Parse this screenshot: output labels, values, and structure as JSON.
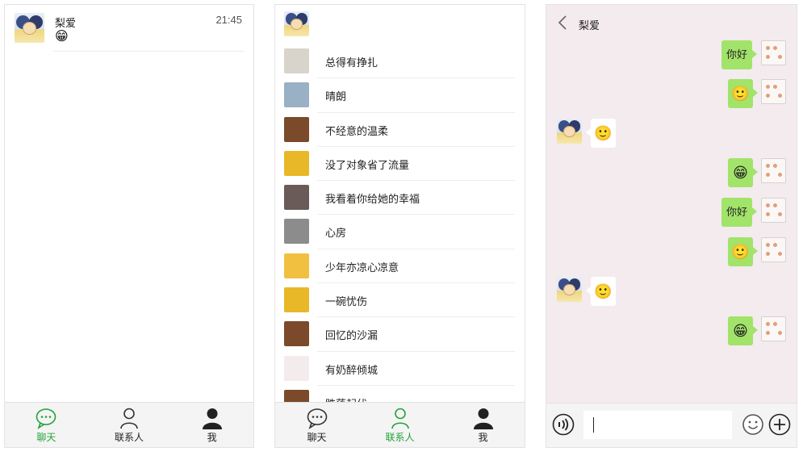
{
  "chats_screen": {
    "chats": [
      {
        "name": "梨爱",
        "time": "21:45",
        "preview": "😁"
      }
    ],
    "tabs": [
      {
        "label": "聊天",
        "icon": "chat-bubble-icon",
        "active": true
      },
      {
        "label": "联系人",
        "icon": "person-outline-icon",
        "active": false
      },
      {
        "label": "我",
        "icon": "person-filled-icon",
        "active": false
      }
    ]
  },
  "contacts_screen": {
    "contacts": [
      {
        "name": "总得有挣扎",
        "avatar_color": "#d8d4cc"
      },
      {
        "name": "晴朗",
        "avatar_color": "#9ab0c4"
      },
      {
        "name": "不经意的温柔",
        "avatar_color": "#7a4a2a"
      },
      {
        "name": "没了对象省了流量",
        "avatar_color": "#e8b828"
      },
      {
        "name": "我看着你给她的幸福",
        "avatar_color": "#6a5a58"
      },
      {
        "name": "心房",
        "avatar_color": "#8c8c8c"
      },
      {
        "name": "少年亦凉心凉意",
        "avatar_color": "#f2c040"
      },
      {
        "name": "一碗忧伤",
        "avatar_color": "#e8b828"
      },
      {
        "name": "回忆的沙漏",
        "avatar_color": "#7a4a2a"
      },
      {
        "name": "有奶醉倾城",
        "avatar_color": "#f4ecec"
      },
      {
        "name": "跌落起伏",
        "avatar_color": "#7a4a2a"
      }
    ],
    "tabs": [
      {
        "label": "聊天",
        "icon": "chat-bubble-icon",
        "active": false
      },
      {
        "label": "联系人",
        "icon": "person-outline-icon",
        "active": true
      },
      {
        "label": "我",
        "icon": "person-filled-icon",
        "active": false
      }
    ]
  },
  "conversation_screen": {
    "title": "梨爱",
    "messages": [
      {
        "side": "right",
        "text": "你好"
      },
      {
        "side": "right",
        "text": "🙂"
      },
      {
        "side": "left",
        "text": "🙂"
      },
      {
        "side": "right",
        "text": "😁"
      },
      {
        "side": "right",
        "text": "你好"
      },
      {
        "side": "right",
        "text": "🙂"
      },
      {
        "side": "left",
        "text": "🙂"
      },
      {
        "side": "right",
        "text": "😁"
      }
    ],
    "input_value": ""
  },
  "colors": {
    "accent_green": "#22a33a",
    "bubble_green": "#a2e36a",
    "chat_bg": "#f3ebee"
  }
}
